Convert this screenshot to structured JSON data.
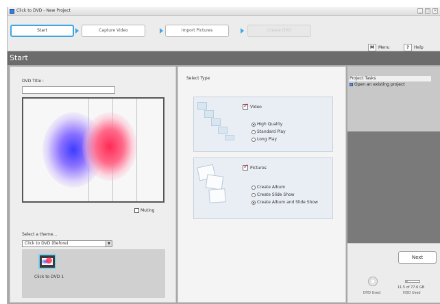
{
  "window": {
    "title": "Click to DVD - New Project"
  },
  "wizard": {
    "steps": [
      {
        "label": "Start",
        "state": "active"
      },
      {
        "label": "Capture Video",
        "state": "normal"
      },
      {
        "label": "Import Pictures",
        "state": "normal"
      },
      {
        "label": "Create DVD",
        "state": "disabled"
      }
    ],
    "menu": {
      "key": "M",
      "label": "Menu"
    },
    "help": {
      "key": "?",
      "label": "Help"
    }
  },
  "section": {
    "title": "Start"
  },
  "left": {
    "dvd_title_label": "DVD Title :",
    "dvd_title_value": "",
    "muting_label": "Muting",
    "theme_label": "Select a theme...",
    "theme_select_value": "Click to DVD (Before)",
    "theme_item_label": "Click to DVD 1"
  },
  "middle": {
    "select_type_label": "Select Type",
    "video": {
      "label": "Video",
      "options": [
        "High Quality",
        "Standard Play",
        "Long Play"
      ],
      "selected": 0
    },
    "pictures": {
      "label": "Pictures",
      "options": [
        "Create Album",
        "Create Slide Show",
        "Create Album and Slide Show"
      ],
      "selected": 2
    }
  },
  "right": {
    "tasks_header": "Project Tasks",
    "task_open": "Open an existing project",
    "next_label": "Next",
    "dvd_used_label": "DVD Used",
    "hdd_size": "11.5 of 77.6 GB",
    "hdd_used_label": "HDD Used",
    "hdd_used_fraction": 0.15
  },
  "colors": {
    "accent": "#3fa7e0",
    "check": "#e0102a",
    "section_bar": "#6c6c6c"
  }
}
